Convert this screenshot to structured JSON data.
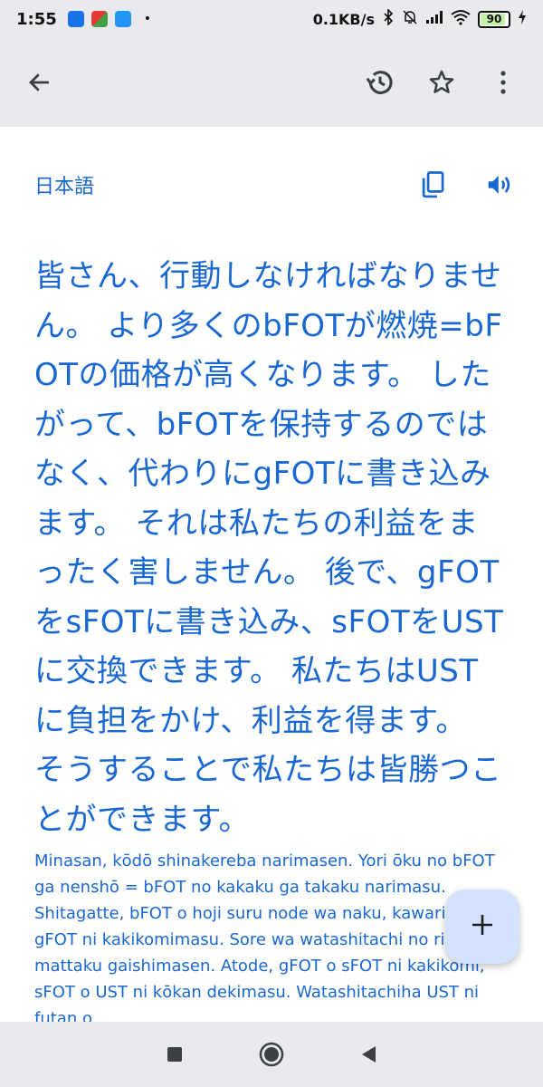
{
  "status_bar": {
    "time": "1:55",
    "dot": "•",
    "net_speed": "0.1KB/s",
    "battery": "90"
  },
  "app_bar": {
    "icons": [
      "back-arrow-icon",
      "history-icon",
      "star-icon",
      "more-vert-icon"
    ]
  },
  "translation_panel": {
    "language_label": "日本語",
    "translated_text": "皆さん、行動しなければなりません。 より多くのbFOTが燃焼=bFOTの価格が高くなります。 したがって、bFOTを保持するのではなく、代わりにgFOTに書き込みます。 それは私たちの利益をまったく害しません。 後で、gFOTをsFOTに書き込み、sFOTをUSTに交換できます。 私たちはUSTに負担をかけ、利益を得ます。 そうすることで私たちは皆勝つことができます。",
    "romanization": "Minasan, kōdō shinakereba narimasen. Yori ōku no bFOT ga nenshō = bFOT no kakaku ga takaku narimasu. Shitagatte, bFOT o hoji suru node wa naku, kawarini gFOT ni kakikomimasu. Sore wa watashitachi no rieki o mattaku gaishimasen. Atode, gFOT o sFOT ni kakikomi, sFOT o UST ni kōkan dekimasu. Watashitachiha UST ni futan o"
  },
  "fab": {
    "icon": "plus-icon"
  },
  "nav_bar": {
    "icons": [
      "recents-square-icon",
      "home-circle-icon",
      "back-triangle-icon"
    ]
  },
  "colors": {
    "accent": "#1967d2",
    "bar_background": "#e8eaed",
    "fab_background": "#d3e3fd"
  }
}
